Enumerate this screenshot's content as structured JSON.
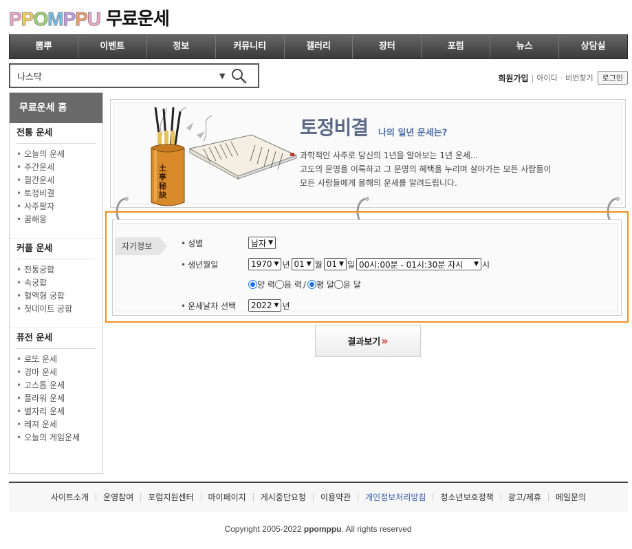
{
  "header": {
    "logo_letters": [
      "P",
      "P",
      "O",
      "M",
      "P",
      "P",
      "U"
    ],
    "title": "무료운세"
  },
  "nav": [
    "뽐뿌",
    "이벤트",
    "정보",
    "커뮤니티",
    "갤러리",
    "장터",
    "포럼",
    "뉴스",
    "상담실"
  ],
  "search": {
    "value": "나스닥"
  },
  "member": {
    "join": "회원가입",
    "id_find": "아이디",
    "pw_find": "비번찾기",
    "login": "로그인"
  },
  "sidebar": {
    "home": "무료운세 홈",
    "sections": [
      {
        "title": "전통 운세",
        "items": [
          "오늘의 운세",
          "주간운세",
          "월간운세",
          "토정비결",
          "사주팔자",
          "꿈해몽"
        ]
      },
      {
        "title": "커플 운세",
        "items": [
          "전통궁합",
          "속궁합",
          "혈액형 궁합",
          "첫데이트 궁합"
        ]
      },
      {
        "title": "퓨전 운세",
        "items": [
          "로또 운세",
          "경마 운세",
          "고스톱 운세",
          "플라워 운세",
          "별자리 운세",
          "레져 운세",
          "오늘의 게임운세"
        ]
      }
    ]
  },
  "banner": {
    "title": "토정비결",
    "subtitle": "나의 일년 운세는?",
    "desc": [
      "과학적인 사주로 당신의 1년을 알아보는 1년 운세...",
      "고도의 문명을 이룩하고 그 문명의 혜택을 누리며 살아가는 모든 사람들이",
      "모든 사람들에게 올해의 운세를 알려드립니다."
    ],
    "book_label": "土亭秘訣"
  },
  "form": {
    "tag": "자기정보",
    "gender_label": "성별",
    "gender_value": "남자",
    "birth_label": "생년월일",
    "year": "1970",
    "year_unit": "년",
    "month": "01",
    "month_unit": "월",
    "day": "01",
    "day_unit": "일",
    "time": "00시:00분 - 01시:30분 자시",
    "time_unit": "시",
    "solar": "양 력",
    "lunar": "음 력",
    "slash": "/",
    "normal_month": "평 달",
    "leap_month": "윤 달",
    "fortune_label": "운세날자 선택",
    "fortune_year": "2022",
    "fortune_unit": "년"
  },
  "result_button": {
    "label": "결과보기",
    "mark": "»"
  },
  "footer": {
    "links": [
      "사이트소개",
      "운영참여",
      "포럼지원센터",
      "마이페이지",
      "게시중단요청",
      "이용약관",
      "개인정보처리방침",
      "청소년보호정책",
      "광고/제휴",
      "메일문의"
    ],
    "copyright_prefix": "Copyright 2005-2022 ",
    "copyright_brand": "ppomppu",
    "copyright_suffix": ". All rights reserved"
  },
  "colors": {
    "accent": "#f5901e",
    "nav_bg": "#4a4a4a",
    "banner_title": "#5a6a85",
    "privacy_link": "#3b5ea8"
  }
}
